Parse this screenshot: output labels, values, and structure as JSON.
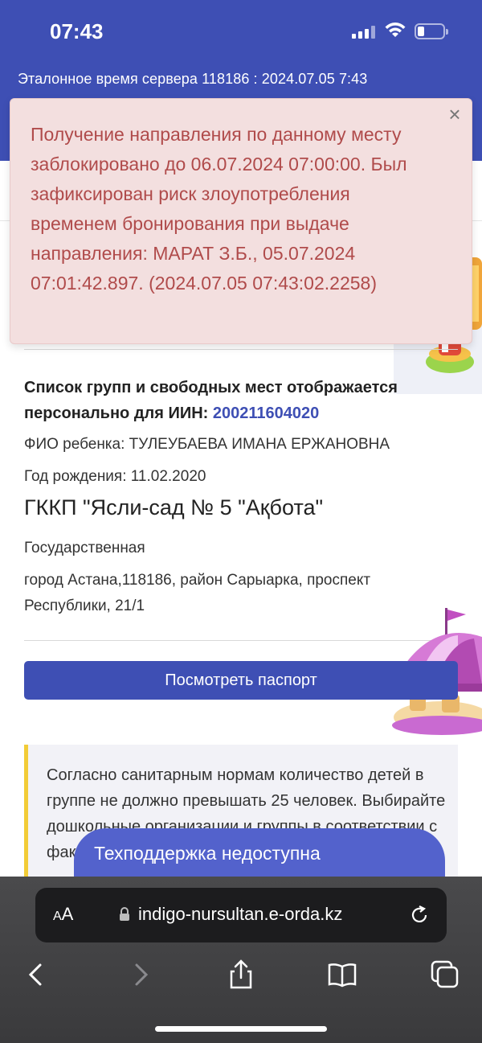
{
  "status_bar": {
    "time": "07:43"
  },
  "header": {
    "server_time": "Эталонное время сервера 118186 : 2024.07.05 7:43"
  },
  "alert": {
    "message": "Получение направления по данному месту заблокировано до 06.07.2024 07:00:00. Был зафиксирован риск злоупотребления временем бронирования при выдаче направления: МАРАТ З.Б., 05.07.2024 07:01:42.897. (2024.07.05 07:43:02.2258)",
    "close_label": "×"
  },
  "info": {
    "headline_prefix": "Список групп и свободных мест отображается персонально для ИИН: ",
    "iin": "200211604020",
    "child_name": "ФИО ребенка: ТУЛЕУБАЕВА ИМАНА ЕРЖАНОВНА",
    "birth_year": "Год рождения: 11.02.2020",
    "org_name": "ГККП \"Ясли-сад № 5 \"Ақбота\"",
    "org_type": "Государственная",
    "org_address": "город Астана,118186, район Сарыарка, проспект Республики, 21/1"
  },
  "actions": {
    "passport_button": "Посмотреть паспорт"
  },
  "notice": {
    "text": "Согласно санитарным нормам количество детей в группе не должно превышать 25 человек. Выбирайте дошкольные организации и группы в соответствии с фактическим"
  },
  "support": {
    "label": "Техподдержка недоступна"
  },
  "browser": {
    "aa_small": "A",
    "aa_large": "A",
    "url": "indigo-nursultan.e-orda.kz"
  },
  "colors": {
    "brand": "#3e4fb4",
    "alert_text": "#b04b4b",
    "notice_accent": "#f2cc37"
  }
}
